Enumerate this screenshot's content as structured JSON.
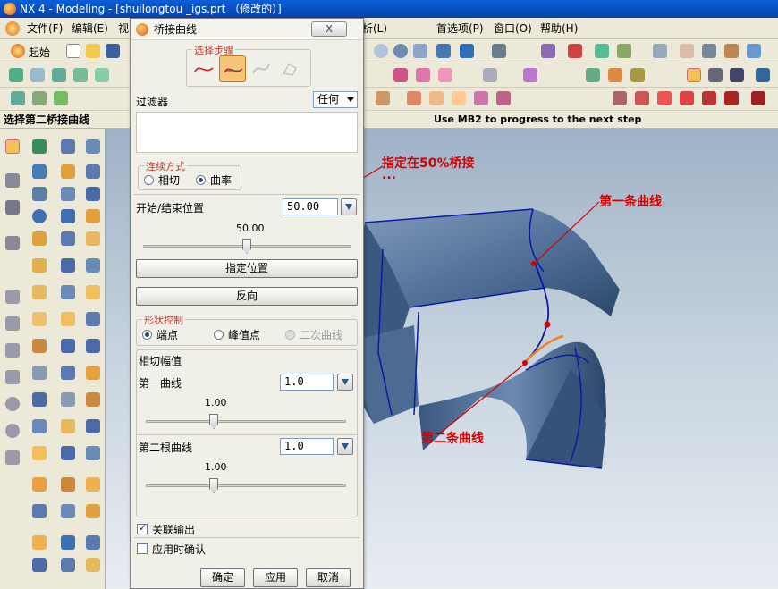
{
  "window": {
    "title": "NX 4 - Modeling - [shuilongtou _igs.prt （修改的）]"
  },
  "menu": [
    {
      "label": "文件(F)"
    },
    {
      "label": "编辑(E)"
    },
    {
      "label": "视"
    },
    {
      "label": "析(L)"
    },
    {
      "label": "首选项(P)"
    },
    {
      "label": "窗口(O)"
    },
    {
      "label": "帮助(H)"
    }
  ],
  "toolbar": {
    "start_label": "起始"
  },
  "status": {
    "prompt": "选择第二桥接曲线",
    "hint": "Use MB2 to progress to the next step"
  },
  "dialog": {
    "title": "桥接曲线",
    "close_label": "X",
    "steps_legend": "选择步骤",
    "filter_label": "过滤器",
    "filter_value": "任何",
    "continuity": {
      "legend": "连续方式",
      "options": [
        "相切",
        "曲率"
      ],
      "selected": "曲率"
    },
    "position": {
      "label": "开始/结束位置",
      "value": "50.00",
      "slider_value": "50.00",
      "fraction": 0.5
    },
    "specify_position_button": "指定位置",
    "reverse_button": "反向",
    "shape": {
      "legend": "形状控制",
      "options": [
        "端点",
        "峰值点",
        "二次曲线"
      ],
      "selected": "端点",
      "disabled": "二次曲线"
    },
    "tangent": {
      "label": "相切幅值",
      "first_label": "第一曲线",
      "first_value": "1.0",
      "first_slider": "1.00",
      "second_label": "第二根曲线",
      "second_value": "1.0",
      "second_slider": "1.00"
    },
    "associative_output": {
      "label": "关联输出",
      "checked": true
    },
    "confirm_on_apply": {
      "label": "应用时确认",
      "checked": false
    },
    "buttons": {
      "ok": "确定",
      "apply": "应用",
      "cancel": "取消"
    }
  },
  "annotations": {
    "bridge_note": "指定在50%桥接",
    "bridge_dots": "...",
    "first_curve": "第一条曲线",
    "second_curve": "第二条曲线"
  },
  "colors": {
    "model_blue": "#4a6b94",
    "annotation_red": "#d40000",
    "bridge_orange": "#f08020",
    "edge_blue": "#0a1aa8"
  }
}
